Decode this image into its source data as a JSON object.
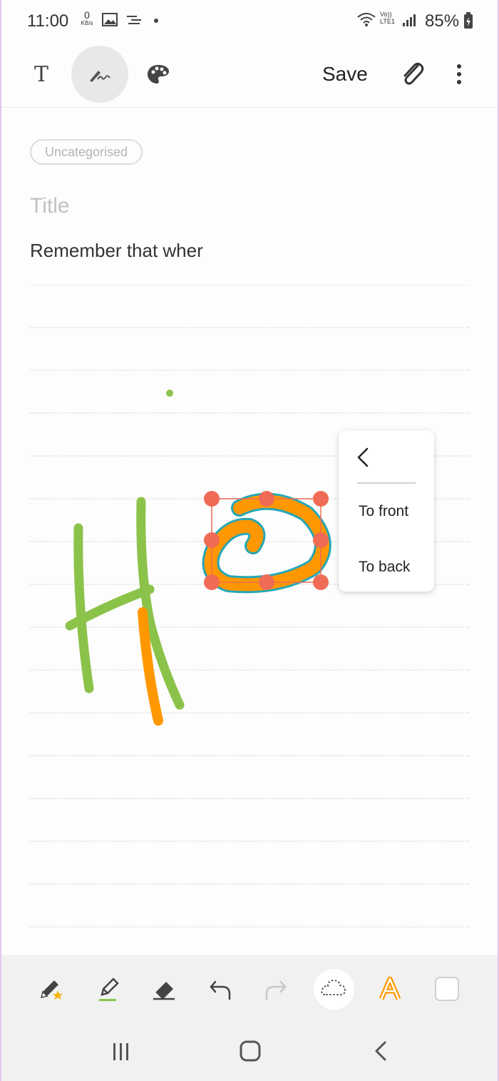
{
  "status_bar": {
    "time": "11:00",
    "data_speed_value": "0",
    "data_speed_unit": "KB/s",
    "volte_line1": "Vo))",
    "volte_line2": "LTE1",
    "battery": "85%"
  },
  "toolbar": {
    "save_label": "Save",
    "text_mode_icon": "T"
  },
  "note": {
    "category": "Uncategorised",
    "title_placeholder": "Title",
    "body_text": "Remember that wher"
  },
  "drawing": {
    "stroke_colors": [
      "#8bc34a",
      "#ff9800"
    ],
    "selection_color": "#f06b55",
    "selection_outline": "#26a6b6"
  },
  "context_menu": {
    "items": [
      "To front",
      "To back"
    ]
  },
  "bottom_toolbar": {
    "tools": [
      "pen-favorites-icon",
      "highlighter-icon",
      "eraser-icon",
      "undo-icon",
      "redo-icon",
      "lasso-icon",
      "text-style-icon",
      "color-swatch-icon"
    ]
  },
  "navigation": {
    "buttons": [
      "recents-icon",
      "home-icon",
      "back-icon"
    ]
  }
}
